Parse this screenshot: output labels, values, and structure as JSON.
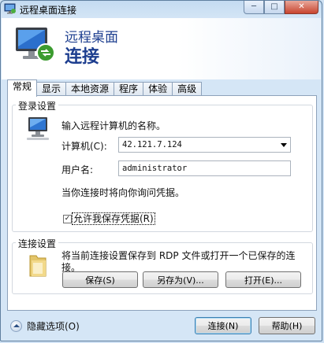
{
  "window": {
    "title": "远程桌面连接"
  },
  "header": {
    "subtitle": "远程桌面",
    "title": "连接"
  },
  "tabs": [
    {
      "label": "常规",
      "active": true
    },
    {
      "label": "显示"
    },
    {
      "label": "本地资源"
    },
    {
      "label": "程序"
    },
    {
      "label": "体验"
    },
    {
      "label": "高级"
    }
  ],
  "login": {
    "legend": "登录设置",
    "prompt": "输入远程计算机的名称。",
    "computer_label": "计算机(C):",
    "computer_value": "42.121.7.124",
    "username_label": "用户名:",
    "username_value": "administrator",
    "credential_note": "当你连接时将向你询问凭据。",
    "save_credentials_label": "允许我保存凭据(R)",
    "save_credentials_checked": true
  },
  "connection": {
    "legend": "连接设置",
    "description": "将当前连接设置保存到 RDP 文件或打开一个已保存的连接。",
    "save_button": "保存(S)",
    "save_as_button": "另存为(V)...",
    "open_button": "打开(E)..."
  },
  "footer": {
    "hide_options": "隐藏选项(O)",
    "connect_button": "连接(N)",
    "help_button": "帮助(H)"
  },
  "icons": {
    "title": "remote-desktop-icon",
    "header": "remote-desktop-monitor-icon",
    "computer": "computer-icon",
    "folder": "folder-icon",
    "hide": "chevron-up-circle-icon"
  }
}
